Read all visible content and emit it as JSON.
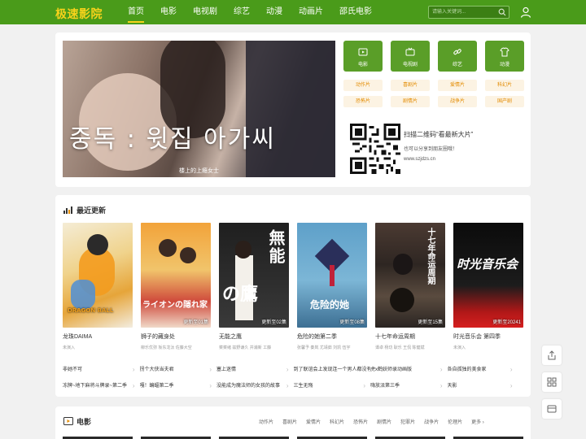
{
  "header": {
    "logo": "极速影院",
    "nav": [
      "首页",
      "电影",
      "电视剧",
      "综艺",
      "动漫",
      "动画片",
      "邵氏电影"
    ],
    "search_placeholder": "请输入关键词..."
  },
  "banner": {
    "title": "중독 : 윗집 아가씨",
    "caption": "楼上的上瘾女士"
  },
  "categories": [
    "电影",
    "电视剧",
    "综艺",
    "动漫"
  ],
  "genres": [
    "动作片",
    "喜剧片",
    "爱情片",
    "科幻片",
    "恐怖片",
    "剧情片",
    "战争片",
    "国产剧"
  ],
  "qr": {
    "title": "扫描二维码“看最新大片”",
    "subtitle": "也可以分享到朋友圈哦！",
    "url": "www.szjdzs.cn"
  },
  "latest": {
    "heading": "最近更新",
    "posters": [
      {
        "title": "龙珠DAIMA",
        "actors": "未演入",
        "badge": ""
      },
      {
        "title": "狮子的藏身处",
        "actors": "柳乐优弥 坂东龙汰 佐藤大空",
        "badge": "更新至01集"
      },
      {
        "title": "无能之鹰",
        "actors": "菜菜绪 兹野谦久 井浦新 工藤",
        "badge": "更新至02集"
      },
      {
        "title": "危险的她第二季",
        "actors": "张馨予 秦岚 尤靖茹 刘凯 伍宇",
        "badge": "更新至08集"
      },
      {
        "title": "十七年命运周期",
        "actors": "谭卓 杨玏 耿乐 王侃 陈健斌",
        "badge": "更新至15集"
      },
      {
        "title": "时光音乐会 第四季",
        "actors": "未演入",
        "badge": "更新至20241"
      }
    ],
    "links": [
      "非她不可",
      "拐个大侠当夫君",
      "塞上迷情",
      "到了联谊会上发现连一个男人都没有",
      "虎x鹤妖师录动画版",
      "各自孤独的美食家",
      "冻牌~地下麻将斗牌录~第二季",
      "嘎！蝙蝠第二季",
      "没能成为魔法师的女孩的故事",
      "三生无殇",
      "嗨放派第三季",
      "天影"
    ]
  },
  "movies": {
    "heading": "电影",
    "tabs": [
      "动作片",
      "喜剧片",
      "爱情片",
      "科幻片",
      "恐怖片",
      "剧情片",
      "犯罪片",
      "战争片",
      "伦理片",
      "更多 ›"
    ]
  },
  "poster_texts": {
    "p1": "DRAGON BALL",
    "p2": "ライオンの隠れ家",
    "p3a": "無能",
    "p3b": "の鷹",
    "p4": "危险的她",
    "p5": "十七年命运周期",
    "p6": "时光音乐会"
  },
  "colors": {
    "header_bg": "#4a9b1a",
    "logo": "#f7d21b",
    "tile_bg": "#5a9e28",
    "genre_fg": "#e38b00"
  }
}
